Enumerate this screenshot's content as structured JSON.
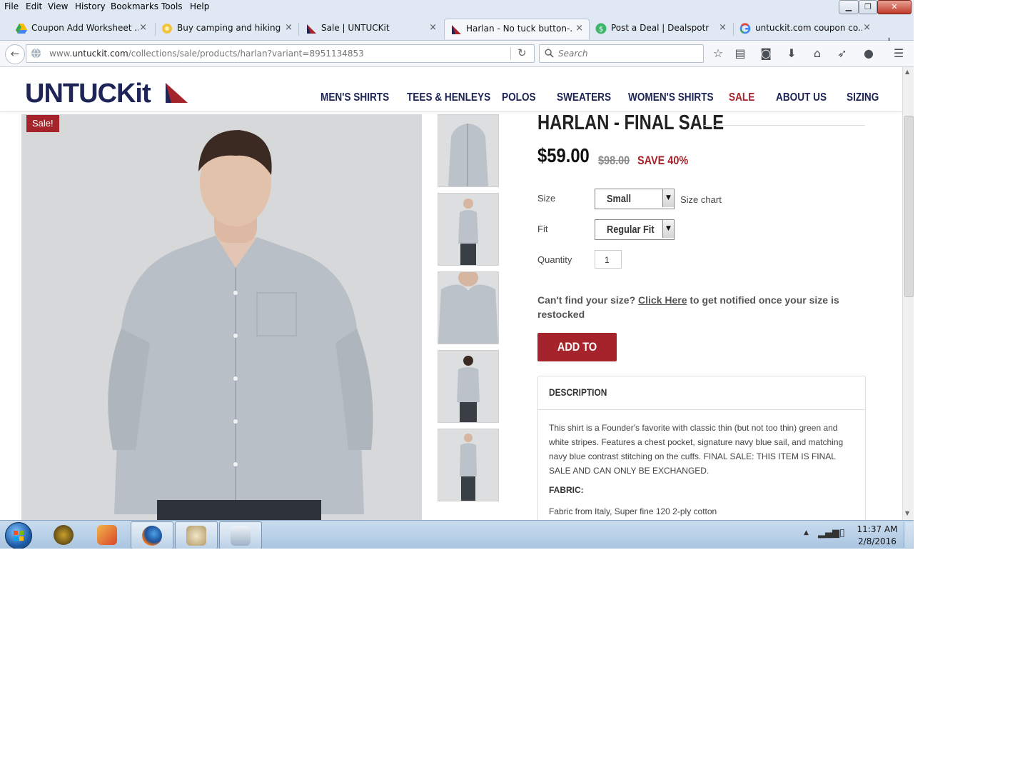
{
  "menubar": {
    "items": [
      {
        "label": "File"
      },
      {
        "label": "Edit"
      },
      {
        "label": "View"
      },
      {
        "label": "History"
      },
      {
        "label": "Bookmarks"
      },
      {
        "label": "Tools"
      },
      {
        "label": "Help"
      }
    ]
  },
  "tabs": [
    {
      "label": "Coupon Add Worksheet ...",
      "icon": "google-drive-icon",
      "close": "×",
      "active": false
    },
    {
      "label": "Buy camping and hiking ...",
      "icon": "sun-icon",
      "close": "×",
      "active": false
    },
    {
      "label": "Sale | UNTUCKit",
      "icon": "untuckit-sail-icon",
      "close": "×",
      "active": false
    },
    {
      "label": "Harlan - No tuck button-...",
      "icon": "untuckit-sail-icon",
      "close": "×",
      "active": true
    },
    {
      "label": "Post a Deal | Dealspotr",
      "icon": "dealspotr-icon",
      "close": "×",
      "active": false
    },
    {
      "label": "untuckit.com coupon co...",
      "icon": "google-icon",
      "close": "×",
      "active": false
    }
  ],
  "newtab": "+",
  "urlbar": {
    "prefix": "www.",
    "domain": "untuckit.com",
    "path": "/collections/sale/products/harlan?variant=8951134853"
  },
  "search": {
    "placeholder": "Search"
  },
  "site": {
    "logo": "UNTUCKit",
    "nav": [
      "MEN'S SHIRTS",
      "TEES & HENLEYS",
      "POLOS",
      "SWEATERS",
      "WOMEN'S SHIRTS",
      "SALE",
      "ABOUT US",
      "SIZING"
    ]
  },
  "product": {
    "badge": "Sale!",
    "title": "HARLAN - FINAL SALE",
    "price": "$59.00",
    "old_price": "$98.00",
    "save": "SAVE 40%",
    "size_label": "Size",
    "size_value": "Small",
    "size_chart": "Size chart",
    "fit_label": "Fit",
    "fit_value": "Regular Fit",
    "qty_label": "Quantity",
    "qty_value": "1",
    "notify_before": "Can't find your size? ",
    "notify_link": "Click Here",
    "notify_after": " to get notified once your size is restocked",
    "add_to_cart": "ADD TO CART",
    "desc_heading": "DESCRIPTION",
    "desc_text": "This shirt is a Founder's favorite with classic thin (but not too thin) green and white stripes. Features a chest pocket, signature navy blue sail, and matching navy blue contrast stitching on the cuffs. FINAL SALE: THIS ITEM IS FINAL SALE AND CAN ONLY BE EXCHANGED.",
    "fabric_label": "FABRIC:",
    "fabric_text": "Fabric from Italy, Super fine 120 2-ply cotton"
  },
  "colors": {
    "brand_navy": "#1e2556",
    "brand_red": "#a5232a"
  },
  "taskbar": {
    "apps": [
      "world-of-warcraft-icon",
      "photo-viewer-icon",
      "firefox-icon",
      "paint-icon",
      "calculator-icon"
    ],
    "time": "11:37 AM",
    "date": "2/8/2016"
  }
}
